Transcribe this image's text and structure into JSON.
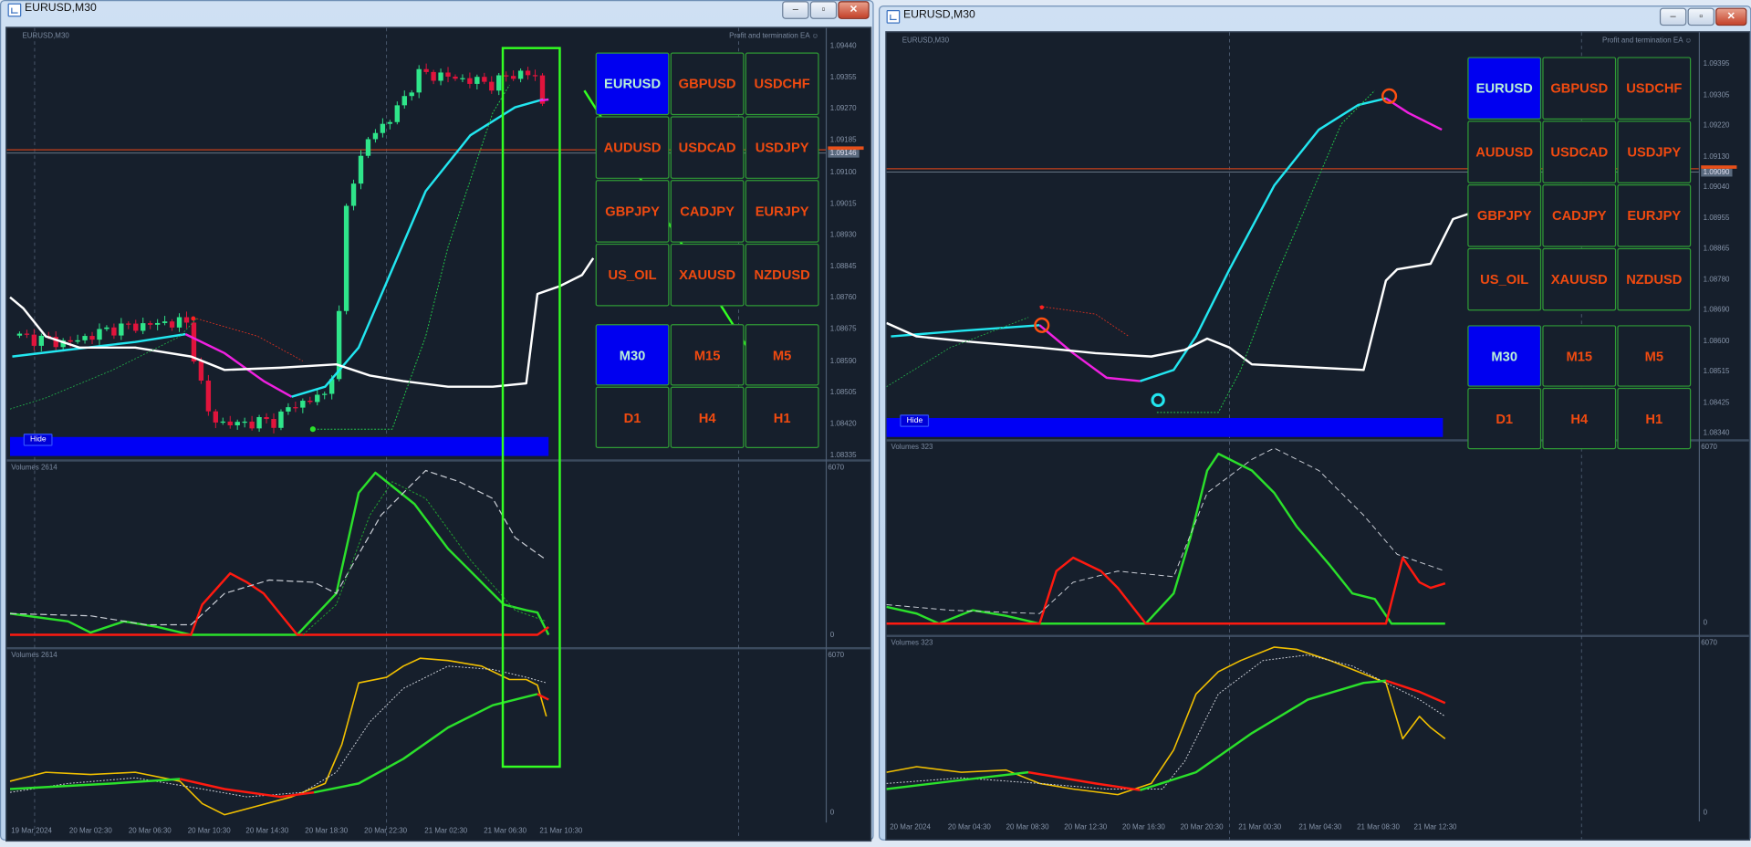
{
  "windows": [
    {
      "title": "EURUSD,M30",
      "chart_label": "EURUSD,M30",
      "ea_label": "Profit and termination EA ☺",
      "price_axis": [
        "1.09440",
        "1.09355",
        "1.09270",
        "1.09185",
        "1.09100",
        "1.09015",
        "1.08930",
        "1.08845",
        "1.08760",
        "1.08675",
        "1.08590",
        "1.08505",
        "1.08420",
        "1.08335"
      ],
      "current_price": "1.09146",
      "volume_panels": [
        {
          "label": "Volumes 2614",
          "max": "6070",
          "min": "0"
        },
        {
          "label": "Volumes 2614",
          "max": "6070",
          "min": "0"
        }
      ],
      "time_axis": [
        "19 Mar 2024",
        "20 Mar 02:30",
        "20 Mar 06:30",
        "20 Mar 10:30",
        "20 Mar 14:30",
        "20 Mar 18:30",
        "20 Mar 22:30",
        "21 Mar 02:30",
        "21 Mar 06:30",
        "21 Mar 10:30"
      ],
      "hide_label": "Hide",
      "symbols": [
        "EURUSD",
        "GBPUSD",
        "USDCHF",
        "AUDUSD",
        "USDCAD",
        "USDJPY",
        "GBPJPY",
        "CADJPY",
        "EURJPY",
        "US_OIL",
        "XAUUSD",
        "NZDUSD"
      ],
      "active_symbol": "EURUSD",
      "timeframes": [
        "M30",
        "M15",
        "M5",
        "D1",
        "H4",
        "H1"
      ],
      "active_timeframe": "M30"
    },
    {
      "title": "EURUSD,M30",
      "chart_label": "EURUSD,M30",
      "ea_label": "Profit and termination EA ☺",
      "price_axis": [
        "1.09395",
        "1.09305",
        "1.09220",
        "1.09130",
        "1.09040",
        "1.08955",
        "1.08865",
        "1.08780",
        "1.08690",
        "1.08600",
        "1.08515",
        "1.08425",
        "1.08340"
      ],
      "current_price": "1.09090",
      "volume_panels": [
        {
          "label": "Volumes 323",
          "max": "6070",
          "min": "0"
        },
        {
          "label": "Volumes 323",
          "max": "6070",
          "min": "0"
        }
      ],
      "time_axis": [
        "20 Mar 2024",
        "20 Mar 04:30",
        "20 Mar 08:30",
        "20 Mar 12:30",
        "20 Mar 16:30",
        "20 Mar 20:30",
        "21 Mar 00:30",
        "21 Mar 04:30",
        "21 Mar 08:30",
        "21 Mar 12:30"
      ],
      "hide_label": "Hide",
      "symbols": [
        "EURUSD",
        "GBPUSD",
        "USDCHF",
        "AUDUSD",
        "USDCAD",
        "USDJPY",
        "GBPJPY",
        "CADJPY",
        "EURJPY",
        "US_OIL",
        "XAUUSD",
        "NZDUSD"
      ],
      "active_symbol": "EURUSD",
      "timeframes": [
        "M30",
        "M15",
        "M5",
        "D1",
        "H4",
        "H1"
      ],
      "active_timeframe": "M30"
    }
  ],
  "colors": {
    "bull": "#2fe58a",
    "bear": "#e0143c",
    "ma_up": "#22e6f0",
    "ma_down": "#f020e0",
    "annotation": "#33ff22"
  }
}
